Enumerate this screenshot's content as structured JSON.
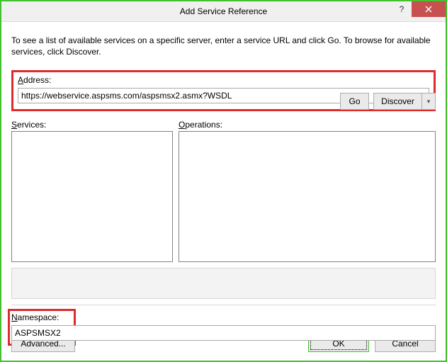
{
  "window": {
    "title": "Add Service Reference"
  },
  "hint": "To see a list of available services on a specific server, enter a service URL and click Go. To browse for available services, click Discover.",
  "address": {
    "label_pre": "A",
    "label_rest": "ddress:",
    "value": "https://webservice.aspsms.com/aspsmsx2.asmx?WSDL"
  },
  "buttons": {
    "go": "Go",
    "discover": "Discover",
    "advanced": "Advanced...",
    "ok": "OK",
    "cancel": "Cancel"
  },
  "labels": {
    "services_pre": "S",
    "services_rest": "ervices:",
    "operations_pre": "O",
    "operations_rest": "perations:",
    "namespace_pre": "N",
    "namespace_rest": "amespace:"
  },
  "namespace": {
    "value": "ASPSMSX2"
  }
}
